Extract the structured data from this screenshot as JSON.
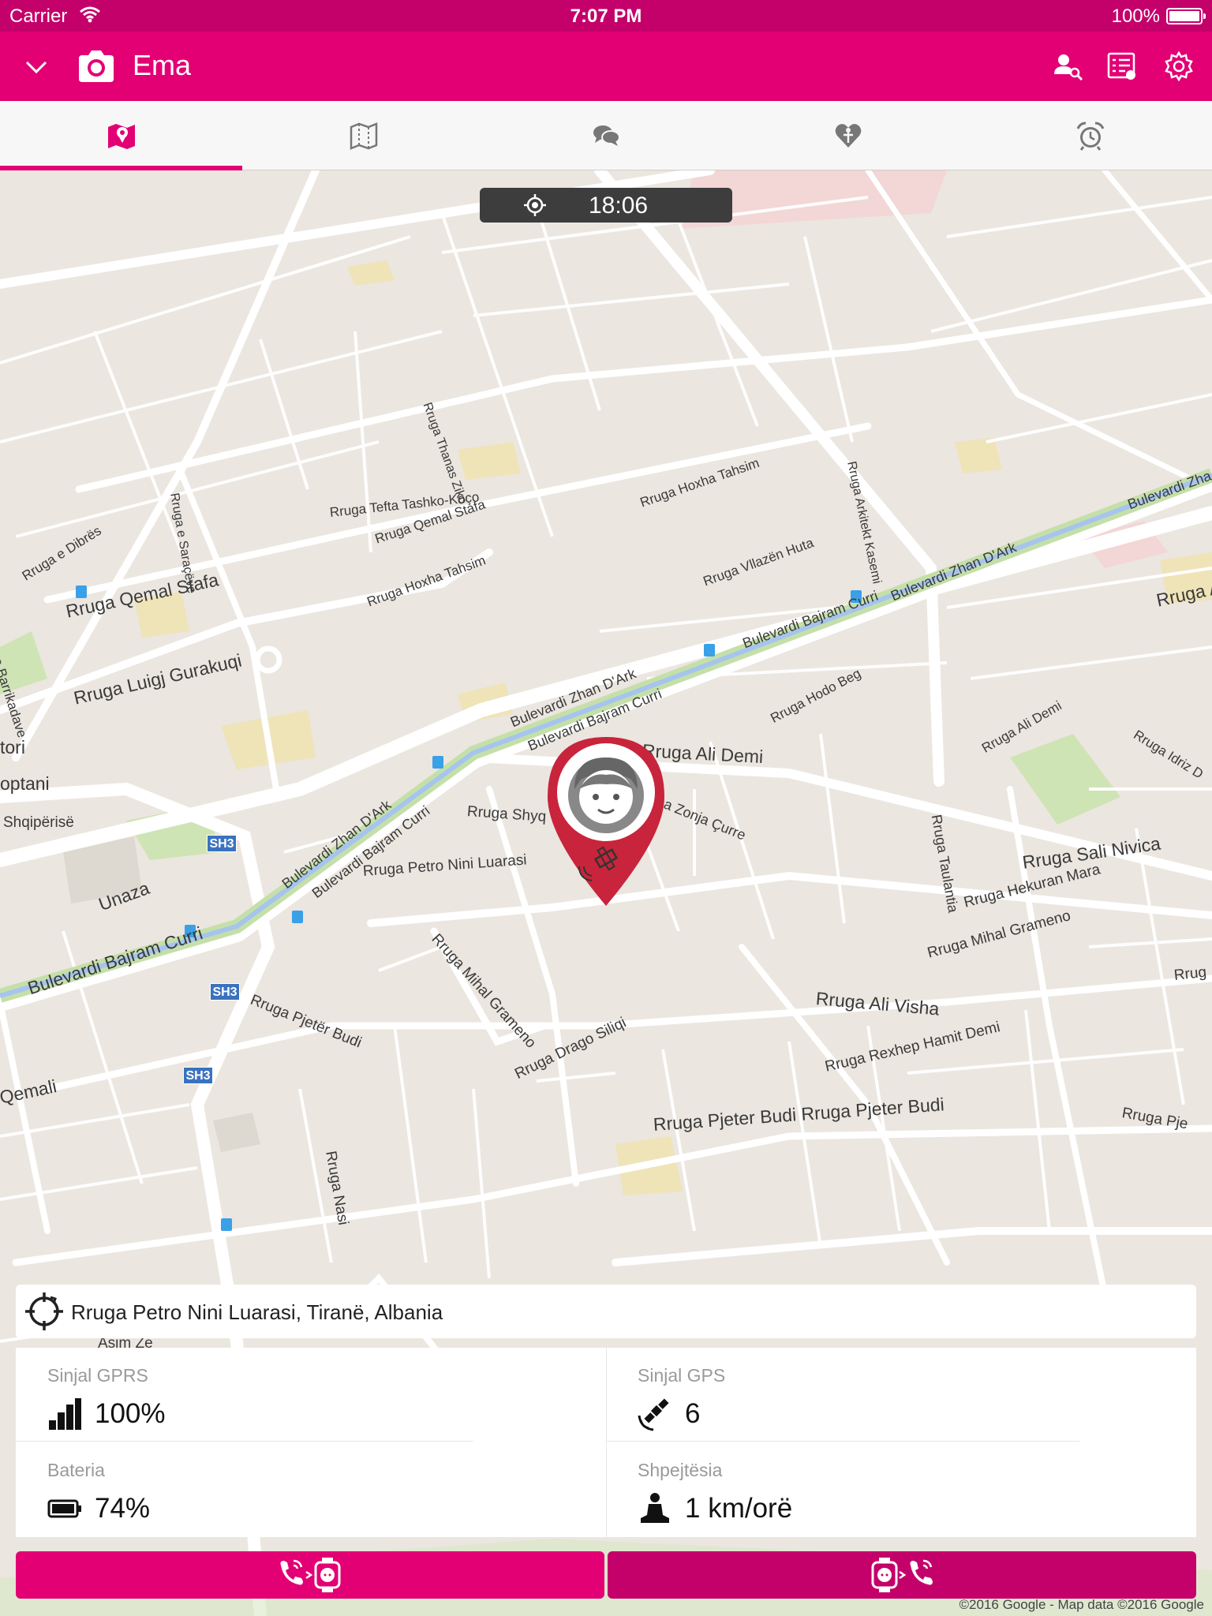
{
  "status_bar": {
    "carrier": "Carrier",
    "time": "7:07 PM",
    "battery": "100%"
  },
  "header": {
    "title": "Ema",
    "accent_color": "#e20074",
    "actions": [
      "person-search-icon",
      "report-icon",
      "settings-icon"
    ]
  },
  "tabs": [
    {
      "icon": "map-pin-icon",
      "active": true
    },
    {
      "icon": "zones-map-icon",
      "active": false
    },
    {
      "icon": "chat-icon",
      "active": false
    },
    {
      "icon": "health-icon",
      "active": false
    },
    {
      "icon": "alarm-clock-icon",
      "active": false
    }
  ],
  "map": {
    "location_time": "18:06",
    "streets": {
      "thanas_ziko": "Rruga Thanas Ziko",
      "e_dibres": "Rruga e Dibrës",
      "e_saracheve": "Rruga e Saraçëve",
      "qemal_stafa_1": "Rruga Qemal Stafa",
      "qemal_stafa_2": "Rruga Qemal Stafa",
      "hoxha_tahsim_1": "Rruga Hoxha Tahsim",
      "hoxha_tahsim_2": "Rruga Hoxha Tahsim",
      "vllazen_huta": "Rruga Vllazën Huta",
      "arkitekt_kasemi": "Rruga Arkitekt Kasemi",
      "zhan_dark_1": "Bulevardi Zhan D'Ark",
      "zhan_dark_2": "Bulevardi Zhan D'Ark",
      "zhan_dark_3": "Bulevardi Zhan D'Ark",
      "zhan_edge": "Bulevardi Zha",
      "rruga_a_edge": "Rruga A",
      "e_barrikadave": "Rruga e Barrikadave",
      "tefta": "Rruga Tefta Tashko-Koço",
      "luigj": "Rruga Luigj Gurakuqi",
      "bajram_1": "Bulevardi Bajram Curri",
      "bajram_2": "Bulevardi Bajram Curri",
      "bajram_3": "Bulevardi Bajram Curri",
      "bajram_4": "Bulevardi Bajram Curri",
      "hodo_beg": "Rruga Hodo Beg",
      "ali_demi_1": "Rruga Ali Demi",
      "ali_demi_2": "Rruga Ali Demi",
      "idriz": "Rruga Idriz D",
      "tori": "tori",
      "optani": "optani",
      "shqiperise": "Shqipërisë",
      "shyqyri": "Rruga Shyq",
      "zonja": "a Zonja Çurre",
      "taulantia": "Rruga Taulantia",
      "petro": "Rruga Petro Nini Luarasi",
      "sali": "Rruga Sali Nivica",
      "hekuran": "Rruga Hekuran Mara",
      "mihal_1": "Rruga Mihal Grameno",
      "mihal_2": "Rruga Mihal Grameno",
      "unaza": "Unaza",
      "pjeter_budi_1": "Rruga Pjetër Budi",
      "pjeter_budi_2": "Rruga Pjeter Budi Rruga Pjeter Budi",
      "ali_visha": "Rruga Ali Visha",
      "drago": "Rruga Drago Siliqi",
      "rexhep": "Rruga Rexhep Hamit Demi",
      "qemali": "Qemali",
      "nasi": "Rruga Nasi",
      "rrug_edge": "Rrug",
      "rruga_pje_edge": "Rruga Pje",
      "asim": "Asim Ze"
    },
    "road_shields": [
      "SH3",
      "SH3",
      "SH3"
    ],
    "copyright": "©2016 Google - Map data ©2016 Google"
  },
  "address": {
    "text": "Rruga Petro Nini Luarasi, Tiranë, Albania"
  },
  "info": {
    "gprs_label": "Sinjal GPRS",
    "gprs_value": "100%",
    "gps_label": "Sinjal GPS",
    "gps_value": "6",
    "battery_label": "Bateria",
    "battery_value": "74%",
    "speed_label": "Shpejtësia",
    "speed_value": "1 km/orë"
  },
  "buttons": {
    "call_watch_icon": "call-watch-icon",
    "watch_callback_icon": "watch-callback-icon",
    "left_color": "#e20074",
    "right_color": "#c4006a"
  }
}
